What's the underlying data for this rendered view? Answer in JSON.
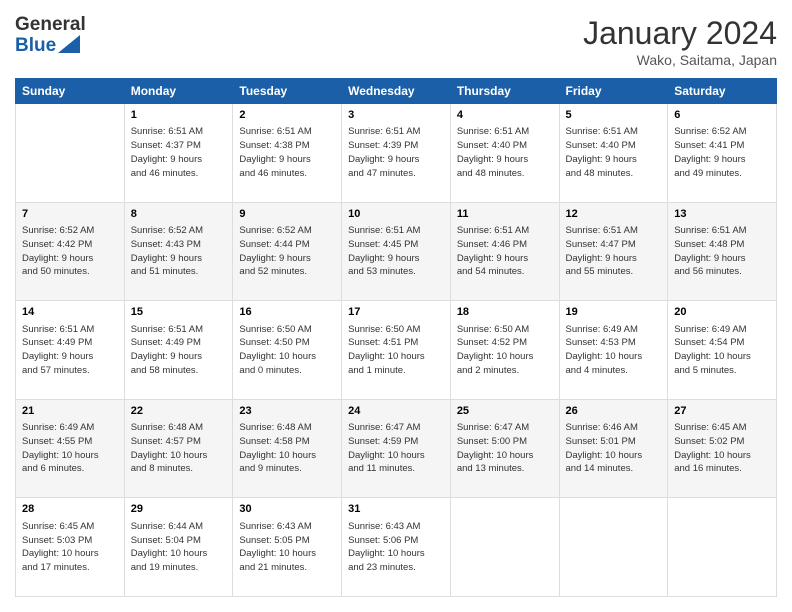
{
  "header": {
    "logo_general": "General",
    "logo_blue": "Blue",
    "title": "January 2024",
    "location": "Wako, Saitama, Japan"
  },
  "weekdays": [
    "Sunday",
    "Monday",
    "Tuesday",
    "Wednesday",
    "Thursday",
    "Friday",
    "Saturday"
  ],
  "weeks": [
    [
      {
        "day": "",
        "sunrise": "",
        "sunset": "",
        "daylight": ""
      },
      {
        "day": "1",
        "sunrise": "Sunrise: 6:51 AM",
        "sunset": "Sunset: 4:37 PM",
        "daylight": "Daylight: 9 hours and 46 minutes."
      },
      {
        "day": "2",
        "sunrise": "Sunrise: 6:51 AM",
        "sunset": "Sunset: 4:38 PM",
        "daylight": "Daylight: 9 hours and 46 minutes."
      },
      {
        "day": "3",
        "sunrise": "Sunrise: 6:51 AM",
        "sunset": "Sunset: 4:39 PM",
        "daylight": "Daylight: 9 hours and 47 minutes."
      },
      {
        "day": "4",
        "sunrise": "Sunrise: 6:51 AM",
        "sunset": "Sunset: 4:40 PM",
        "daylight": "Daylight: 9 hours and 48 minutes."
      },
      {
        "day": "5",
        "sunrise": "Sunrise: 6:51 AM",
        "sunset": "Sunset: 4:40 PM",
        "daylight": "Daylight: 9 hours and 48 minutes."
      },
      {
        "day": "6",
        "sunrise": "Sunrise: 6:52 AM",
        "sunset": "Sunset: 4:41 PM",
        "daylight": "Daylight: 9 hours and 49 minutes."
      }
    ],
    [
      {
        "day": "7",
        "sunrise": "Sunrise: 6:52 AM",
        "sunset": "Sunset: 4:42 PM",
        "daylight": "Daylight: 9 hours and 50 minutes."
      },
      {
        "day": "8",
        "sunrise": "Sunrise: 6:52 AM",
        "sunset": "Sunset: 4:43 PM",
        "daylight": "Daylight: 9 hours and 51 minutes."
      },
      {
        "day": "9",
        "sunrise": "Sunrise: 6:52 AM",
        "sunset": "Sunset: 4:44 PM",
        "daylight": "Daylight: 9 hours and 52 minutes."
      },
      {
        "day": "10",
        "sunrise": "Sunrise: 6:51 AM",
        "sunset": "Sunset: 4:45 PM",
        "daylight": "Daylight: 9 hours and 53 minutes."
      },
      {
        "day": "11",
        "sunrise": "Sunrise: 6:51 AM",
        "sunset": "Sunset: 4:46 PM",
        "daylight": "Daylight: 9 hours and 54 minutes."
      },
      {
        "day": "12",
        "sunrise": "Sunrise: 6:51 AM",
        "sunset": "Sunset: 4:47 PM",
        "daylight": "Daylight: 9 hours and 55 minutes."
      },
      {
        "day": "13",
        "sunrise": "Sunrise: 6:51 AM",
        "sunset": "Sunset: 4:48 PM",
        "daylight": "Daylight: 9 hours and 56 minutes."
      }
    ],
    [
      {
        "day": "14",
        "sunrise": "Sunrise: 6:51 AM",
        "sunset": "Sunset: 4:49 PM",
        "daylight": "Daylight: 9 hours and 57 minutes."
      },
      {
        "day": "15",
        "sunrise": "Sunrise: 6:51 AM",
        "sunset": "Sunset: 4:49 PM",
        "daylight": "Daylight: 9 hours and 58 minutes."
      },
      {
        "day": "16",
        "sunrise": "Sunrise: 6:50 AM",
        "sunset": "Sunset: 4:50 PM",
        "daylight": "Daylight: 10 hours and 0 minutes."
      },
      {
        "day": "17",
        "sunrise": "Sunrise: 6:50 AM",
        "sunset": "Sunset: 4:51 PM",
        "daylight": "Daylight: 10 hours and 1 minute."
      },
      {
        "day": "18",
        "sunrise": "Sunrise: 6:50 AM",
        "sunset": "Sunset: 4:52 PM",
        "daylight": "Daylight: 10 hours and 2 minutes."
      },
      {
        "day": "19",
        "sunrise": "Sunrise: 6:49 AM",
        "sunset": "Sunset: 4:53 PM",
        "daylight": "Daylight: 10 hours and 4 minutes."
      },
      {
        "day": "20",
        "sunrise": "Sunrise: 6:49 AM",
        "sunset": "Sunset: 4:54 PM",
        "daylight": "Daylight: 10 hours and 5 minutes."
      }
    ],
    [
      {
        "day": "21",
        "sunrise": "Sunrise: 6:49 AM",
        "sunset": "Sunset: 4:55 PM",
        "daylight": "Daylight: 10 hours and 6 minutes."
      },
      {
        "day": "22",
        "sunrise": "Sunrise: 6:48 AM",
        "sunset": "Sunset: 4:57 PM",
        "daylight": "Daylight: 10 hours and 8 minutes."
      },
      {
        "day": "23",
        "sunrise": "Sunrise: 6:48 AM",
        "sunset": "Sunset: 4:58 PM",
        "daylight": "Daylight: 10 hours and 9 minutes."
      },
      {
        "day": "24",
        "sunrise": "Sunrise: 6:47 AM",
        "sunset": "Sunset: 4:59 PM",
        "daylight": "Daylight: 10 hours and 11 minutes."
      },
      {
        "day": "25",
        "sunrise": "Sunrise: 6:47 AM",
        "sunset": "Sunset: 5:00 PM",
        "daylight": "Daylight: 10 hours and 13 minutes."
      },
      {
        "day": "26",
        "sunrise": "Sunrise: 6:46 AM",
        "sunset": "Sunset: 5:01 PM",
        "daylight": "Daylight: 10 hours and 14 minutes."
      },
      {
        "day": "27",
        "sunrise": "Sunrise: 6:45 AM",
        "sunset": "Sunset: 5:02 PM",
        "daylight": "Daylight: 10 hours and 16 minutes."
      }
    ],
    [
      {
        "day": "28",
        "sunrise": "Sunrise: 6:45 AM",
        "sunset": "Sunset: 5:03 PM",
        "daylight": "Daylight: 10 hours and 17 minutes."
      },
      {
        "day": "29",
        "sunrise": "Sunrise: 6:44 AM",
        "sunset": "Sunset: 5:04 PM",
        "daylight": "Daylight: 10 hours and 19 minutes."
      },
      {
        "day": "30",
        "sunrise": "Sunrise: 6:43 AM",
        "sunset": "Sunset: 5:05 PM",
        "daylight": "Daylight: 10 hours and 21 minutes."
      },
      {
        "day": "31",
        "sunrise": "Sunrise: 6:43 AM",
        "sunset": "Sunset: 5:06 PM",
        "daylight": "Daylight: 10 hours and 23 minutes."
      },
      {
        "day": "",
        "sunrise": "",
        "sunset": "",
        "daylight": ""
      },
      {
        "day": "",
        "sunrise": "",
        "sunset": "",
        "daylight": ""
      },
      {
        "day": "",
        "sunrise": "",
        "sunset": "",
        "daylight": ""
      }
    ]
  ]
}
